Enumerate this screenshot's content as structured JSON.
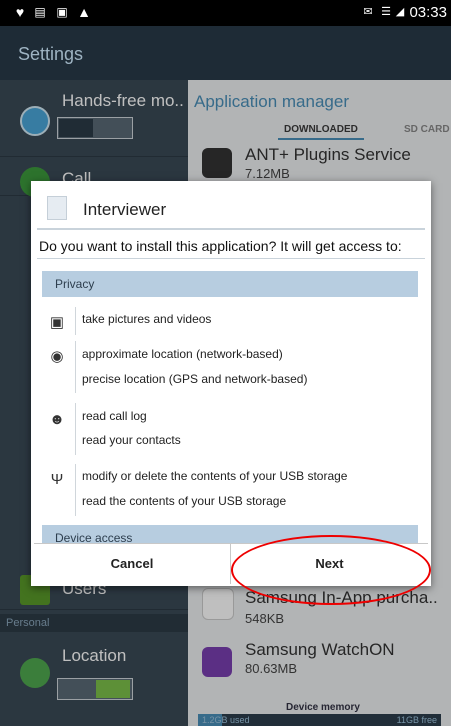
{
  "status_bar": {
    "time": "03:33"
  },
  "app_bar": {
    "title": "Settings"
  },
  "left_pane": {
    "items": [
      {
        "label": "Hands-free mo.."
      },
      {
        "label": "Call"
      },
      {
        "label": "Users"
      }
    ],
    "section_personal": "Personal",
    "location": {
      "label": "Location"
    }
  },
  "right_pane": {
    "title": "Application manager",
    "tabs": [
      "DOWNLOADED",
      "SD CARD"
    ],
    "apps": [
      {
        "name": "ANT+ Plugins Service",
        "size": "7.12MB"
      },
      {
        "name": "Samsung In-App purcha..",
        "size": "548KB"
      },
      {
        "name": "Samsung WatchON",
        "size": "80.63MB"
      }
    ],
    "device_memory": "Device memory",
    "memory_used": "1.2GB used",
    "memory_free": "11GB free"
  },
  "dialog": {
    "app_name": "Interviewer",
    "question": "Do you want to install this application? It will get access to:",
    "sections": [
      {
        "title": "Privacy"
      },
      {
        "title": "Device access"
      }
    ],
    "permissions": [
      {
        "icon": "camera-icon",
        "lines": [
          "take pictures and videos"
        ]
      },
      {
        "icon": "location-pin-icon",
        "lines": [
          "approximate location (network-based)",
          "precise location (GPS and network-based)"
        ]
      },
      {
        "icon": "people-icon",
        "lines": [
          "read call log",
          "read your contacts"
        ]
      },
      {
        "icon": "usb-icon",
        "lines": [
          "modify or delete the contents of your USB storage",
          "read the contents of your USB storage"
        ]
      }
    ],
    "cancel_label": "Cancel",
    "next_label": "Next"
  },
  "colors": {
    "annotation_red": "#e00000",
    "section_header": "#b7cde0",
    "accent_blue": "#4a8fb8"
  }
}
